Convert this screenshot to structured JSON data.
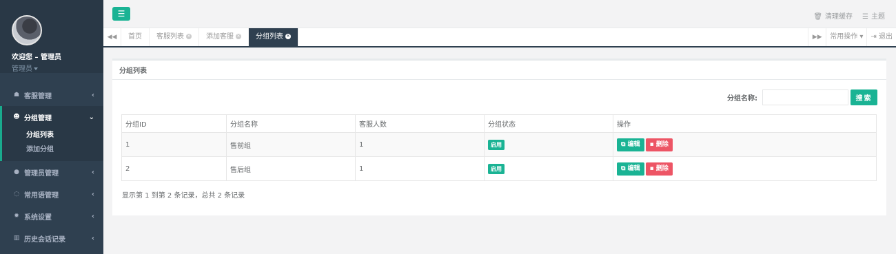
{
  "sidebar": {
    "welcome": "欢迎您 – 管理员",
    "role": "管理员",
    "menu": [
      {
        "icon": "headset-icon",
        "glyph": "☗",
        "label": "客服管理"
      },
      {
        "icon": "users-icon",
        "glyph": "☻",
        "label": "分组管理"
      },
      {
        "icon": "user-icon",
        "glyph": "●",
        "label": "管理员管理"
      },
      {
        "icon": "comments-icon",
        "glyph": "◌",
        "label": "常用语管理"
      },
      {
        "icon": "gear-icon",
        "glyph": "✹",
        "label": "系统设置"
      },
      {
        "icon": "bar-chart-icon",
        "glyph": "▥",
        "label": "历史会话记录"
      }
    ],
    "submenu": [
      "分组列表",
      "添加分组"
    ]
  },
  "header": {
    "menu_glyph": "☰",
    "clear_cache": "清理缓存",
    "theme": "主题"
  },
  "tabs": {
    "items": [
      "首页",
      "客服列表",
      "添加客服",
      "分组列表"
    ],
    "common_ops": "常用操作",
    "logout": "退出"
  },
  "panel": {
    "title": "分组列表",
    "search_label": "分组名称:",
    "search_value": "",
    "search_button": "搜索"
  },
  "table": {
    "headers": [
      "分组ID",
      "分组名称",
      "客服人数",
      "分组状态",
      "操作"
    ],
    "rows": [
      {
        "id": "1",
        "name": "售前组",
        "count": "1",
        "status": "启用",
        "edit": "编辑",
        "delete": "删除"
      },
      {
        "id": "2",
        "name": "售后组",
        "count": "1",
        "status": "启用",
        "edit": "编辑",
        "delete": "删除"
      }
    ]
  },
  "summary": "显示第 1 到第 2 条记录，总共 2 条记录",
  "colors": {
    "primary": "#1ab394",
    "danger": "#ed5565",
    "sidebar": "#2f4050"
  }
}
